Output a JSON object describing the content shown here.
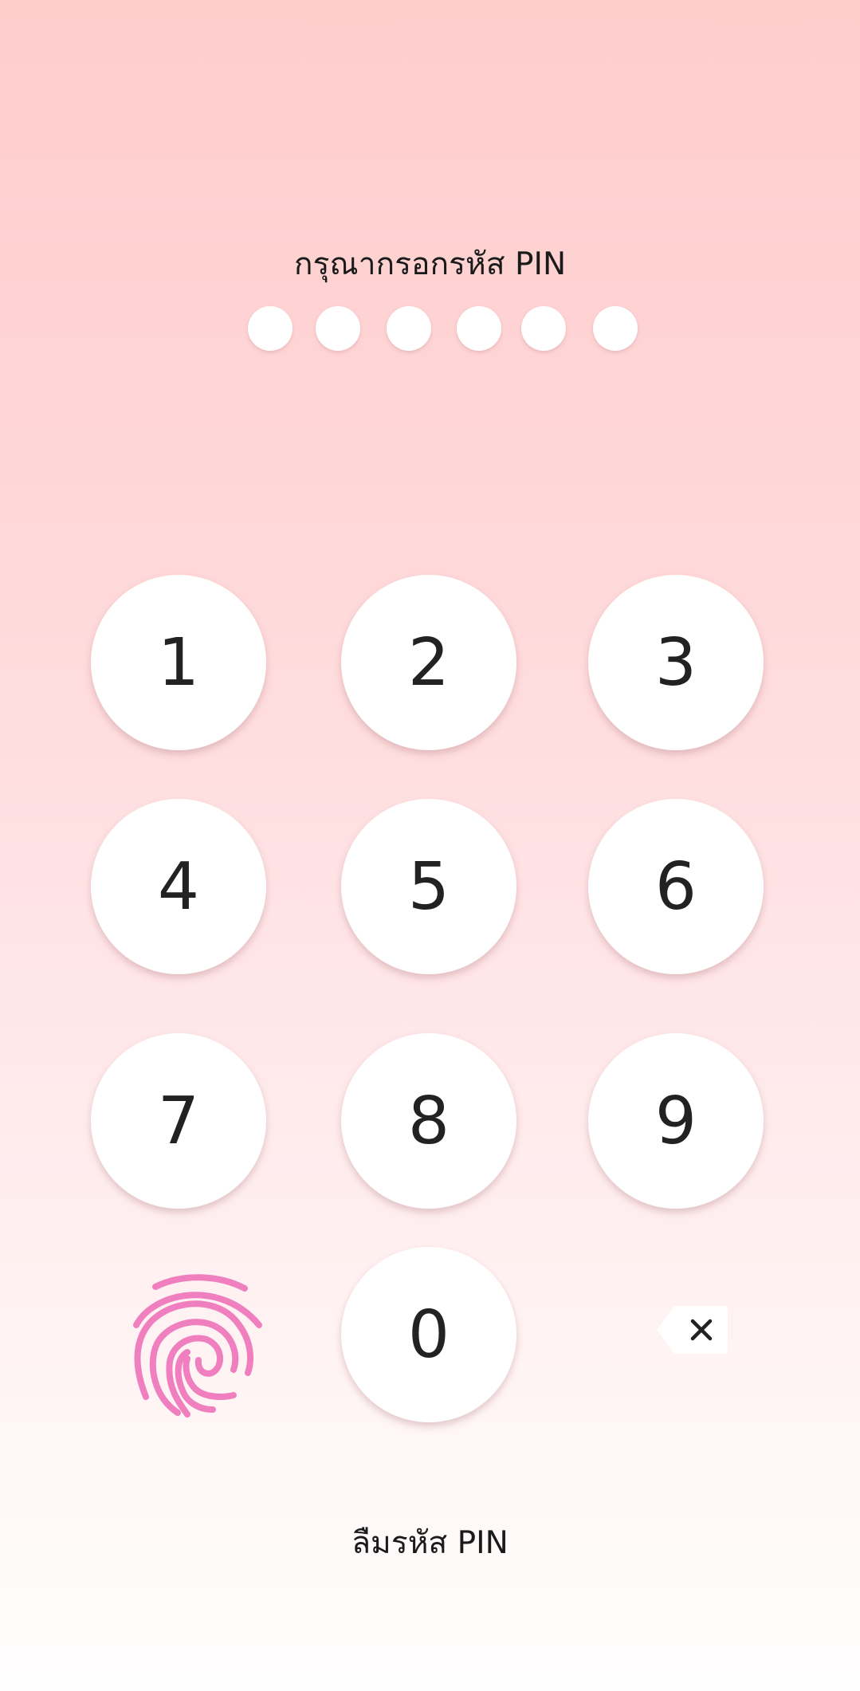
{
  "prompt_text": "กรุณากรอกรหัส PIN",
  "pin_length": 6,
  "pin_entered": 0,
  "keypad": {
    "key_1": "1",
    "key_2": "2",
    "key_3": "3",
    "key_4": "4",
    "key_5": "5",
    "key_6": "6",
    "key_7": "7",
    "key_8": "8",
    "key_9": "9",
    "key_0": "0"
  },
  "icons": {
    "fingerprint": "fingerprint-icon",
    "backspace": "backspace-icon"
  },
  "forgot_pin_label": "ลืมรหัส PIN",
  "colors": {
    "accent": "#ef7fbe",
    "background_top": "#ffcccc",
    "background_bottom": "#fffefe"
  }
}
